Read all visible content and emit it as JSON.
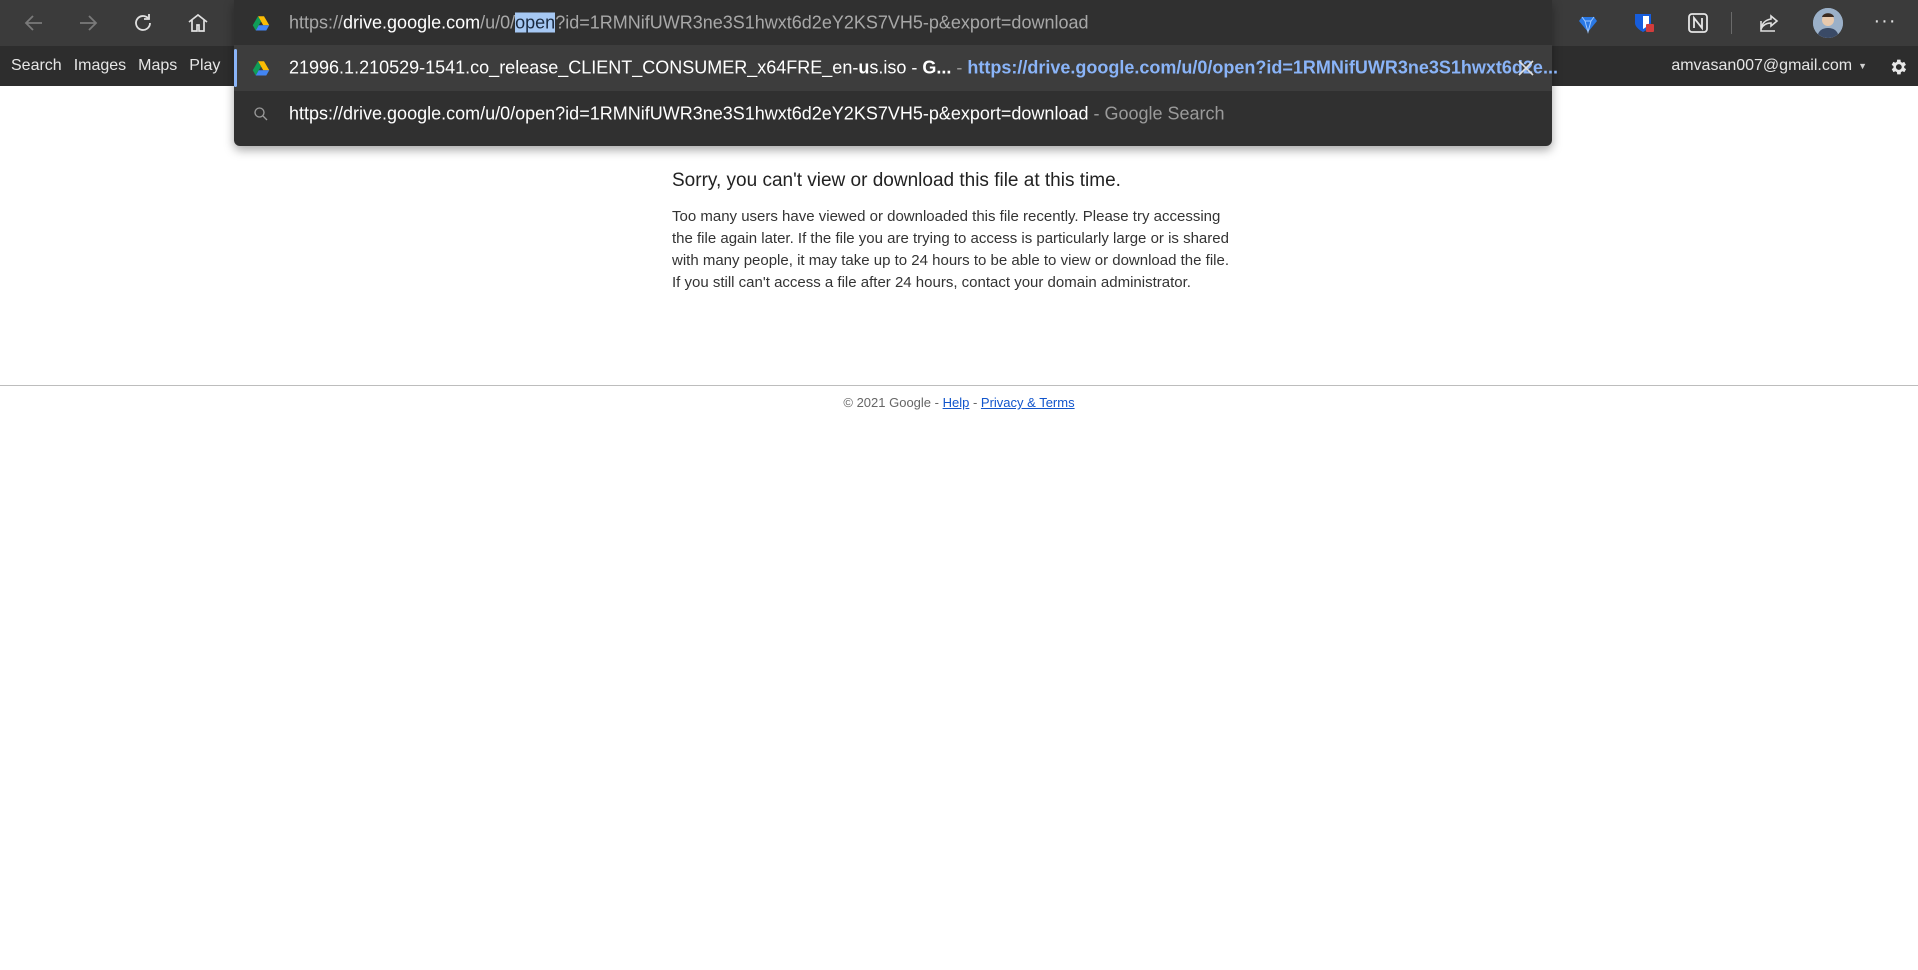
{
  "omnibox": {
    "input": {
      "scheme": "https://",
      "host": "drive.google.com",
      "path_before": "/u/0/",
      "path_selected": "open",
      "path_after": "?id=1RMNifUWR3ne3S1hwxt6d2eY2KS7VH5-p&export=download"
    },
    "suggestion_history": {
      "title_a": "21996.1.210529-1541.co_release_CLIENT_CONSUMER_x64FRE_en-",
      "title_b": "u",
      "title_c": "s.iso - ",
      "title_d": "G...",
      "separator": " - ",
      "url": "https://drive.google.com/u/0/open?id=1RMNifUWR3ne3S1hwxt6d2e..."
    },
    "suggestion_search": {
      "query": "https://drive.google.com/u/0/open?id=1RMNifUWR3ne3S1hwxt6d2eY2KS7VH5-p&export=download",
      "suffix": " - Google Search"
    }
  },
  "gbar": {
    "links": [
      "Search",
      "Images",
      "Maps",
      "Play"
    ],
    "account": "amvasan007@gmail.com"
  },
  "message": {
    "title": "Sorry, you can't view or download this file at this time.",
    "body": "Too many users have viewed or downloaded this file recently. Please try accessing the file again later. If the file you are trying to access is particularly large or is shared with many people, it may take up to 24 hours to be able to view or download the file. If you still can't access a file after 24 hours, contact your domain administrator."
  },
  "footer": {
    "copyright": "© 2021 Google",
    "sep": " - ",
    "help": "Help",
    "privacy": "Privacy & Terms"
  },
  "colors": {
    "toolbar_bg": "#3b3b3b",
    "omnibox_bg": "#303030",
    "selected_row_bg": "#3d3d3d",
    "accent_blue": "#8ab4f8",
    "link_blue": "#1155cc"
  },
  "icons": [
    "back-arrow-icon",
    "forward-arrow-icon",
    "reload-icon",
    "home-icon",
    "google-drive-icon",
    "search-icon",
    "close-icon",
    "extension-gem-icon",
    "bitwarden-icon",
    "notion-icon",
    "share-icon",
    "avatar",
    "more-icon",
    "settings-gear-icon"
  ]
}
